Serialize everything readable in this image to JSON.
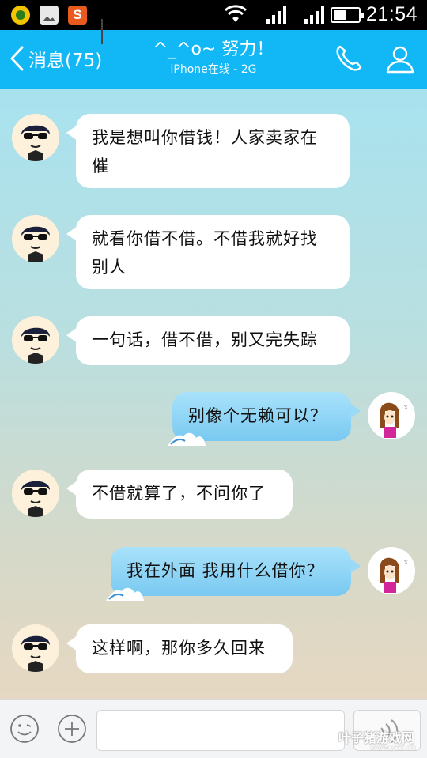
{
  "status_bar": {
    "time": "21:54",
    "app_icon_3_label": "S",
    "battery_level_percent": 50
  },
  "header": {
    "back_label": "消息(75)",
    "title": "^_^o~ 努力！",
    "subtitle": "iPhone在线 - 2G",
    "background_color": "#12b7f5"
  },
  "messages": [
    {
      "side": "left",
      "text": "我是想叫你借钱！人家卖家在催"
    },
    {
      "side": "left",
      "text": "就看你借不借。不借我就好找别人"
    },
    {
      "side": "left",
      "text": "一句话，借不借，别又完失踪"
    },
    {
      "side": "right",
      "text": "别像个无赖可以？"
    },
    {
      "side": "left",
      "text": "不借就算了，不问你了"
    },
    {
      "side": "right",
      "text": "我在外面 我用什么借你？"
    },
    {
      "side": "left",
      "text": "这样啊，那你多久回来"
    }
  ],
  "input_bar": {
    "text_value": "",
    "watermark": "叶子猪游戏网",
    "watermark_url": "www.yzz.cn"
  },
  "icons": {
    "status": [
      "app-icon-1",
      "gallery-icon",
      "sogou-icon",
      "wifi-icon",
      "signal-icon",
      "battery-icon"
    ],
    "header": [
      "back-chevron-icon",
      "phone-icon",
      "profile-icon"
    ],
    "input": [
      "emoji-icon",
      "plus-icon",
      "voice-icon"
    ]
  }
}
